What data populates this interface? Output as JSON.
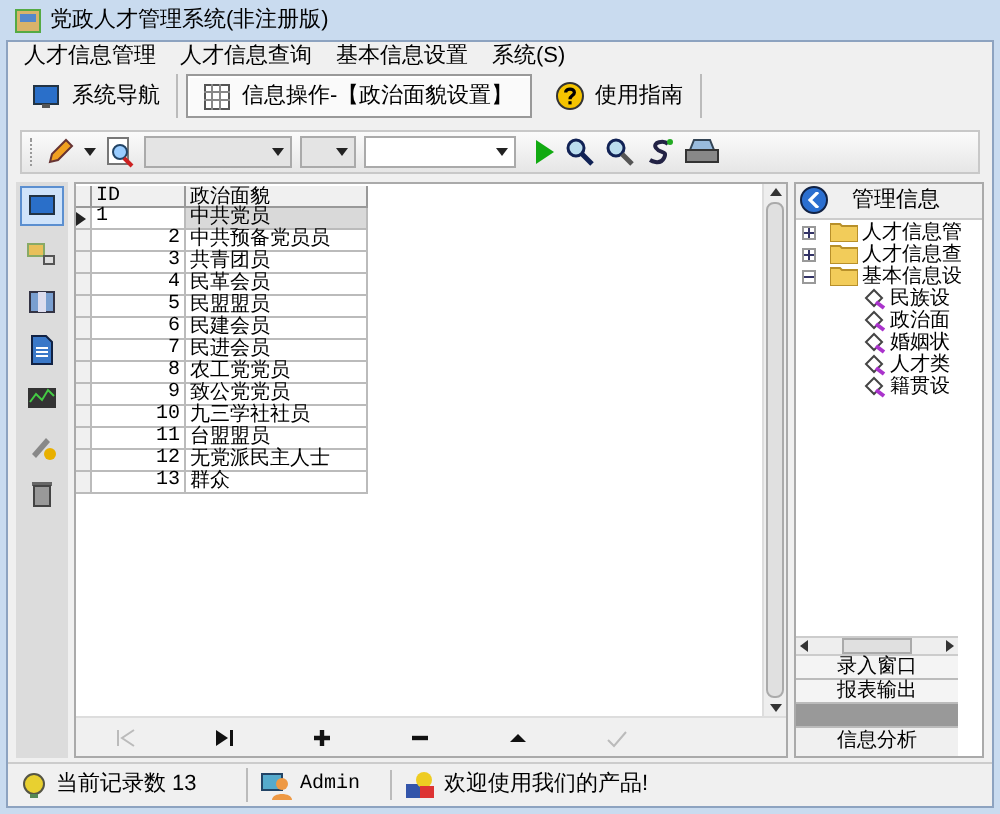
{
  "window": {
    "title": "党政人才管理系统(非注册版)"
  },
  "menu": [
    "人才信息管理",
    "人才信息查询",
    "基本信息设置",
    "系统(S)"
  ],
  "tabs": [
    {
      "label": "系统导航",
      "selected": false
    },
    {
      "label": "信息操作-【政治面貌设置】",
      "selected": true
    },
    {
      "label": "使用指南",
      "selected": false
    }
  ],
  "toolbar": {
    "combos": [
      {
        "kind": "gray"
      },
      {
        "kind": "gray"
      },
      {
        "kind": "white"
      }
    ]
  },
  "side_icons": [
    {
      "selected": true
    },
    {
      "selected": false
    },
    {
      "selected": false
    },
    {
      "selected": false
    },
    {
      "selected": false
    },
    {
      "selected": false
    },
    {
      "selected": false
    }
  ],
  "grid": {
    "columns": [
      "ID",
      "政治面貌"
    ],
    "rows": [
      {
        "id": "1",
        "value": "中共党员",
        "selected": true
      },
      {
        "id": "2",
        "value": "中共预备党员员",
        "selected": false
      },
      {
        "id": "3",
        "value": "共青团员",
        "selected": false
      },
      {
        "id": "4",
        "value": "民革会员",
        "selected": false
      },
      {
        "id": "5",
        "value": "民盟盟员",
        "selected": false
      },
      {
        "id": "6",
        "value": "民建会员",
        "selected": false
      },
      {
        "id": "7",
        "value": "民进会员",
        "selected": false
      },
      {
        "id": "8",
        "value": "农工党党员",
        "selected": false
      },
      {
        "id": "9",
        "value": "致公党党员",
        "selected": false
      },
      {
        "id": "10",
        "value": "九三学社社员",
        "selected": false
      },
      {
        "id": "11",
        "value": "台盟盟员",
        "selected": false
      },
      {
        "id": "12",
        "value": "无党派民主人士",
        "selected": false
      },
      {
        "id": "13",
        "value": "群众",
        "selected": false
      }
    ]
  },
  "navigator": [
    {
      "kind": "first",
      "disabled": true
    },
    {
      "kind": "last",
      "disabled": false
    },
    {
      "kind": "add",
      "disabled": false
    },
    {
      "kind": "delete",
      "disabled": false
    },
    {
      "kind": "up",
      "disabled": false
    },
    {
      "kind": "post",
      "disabled": true
    }
  ],
  "panel": {
    "title": "管理信息",
    "tree": [
      {
        "label": "人才信息管",
        "expanded": false
      },
      {
        "label": "人才信息查",
        "expanded": false
      },
      {
        "label": "基本信息设",
        "expanded": true,
        "children": [
          {
            "label": "民族设"
          },
          {
            "label": "政治面"
          },
          {
            "label": "婚姻状"
          },
          {
            "label": "人才类"
          },
          {
            "label": "籍贯设"
          }
        ]
      }
    ],
    "buttons": [
      {
        "label": "录入窗口",
        "selected": false
      },
      {
        "label": "报表输出",
        "selected": false
      },
      {
        "selected": true
      }
    ],
    "bottom_button": "信息分析"
  },
  "status_bar": {
    "records": "当前记录数 13",
    "user": "Admin",
    "message": "欢迎使用我们的产品!"
  }
}
